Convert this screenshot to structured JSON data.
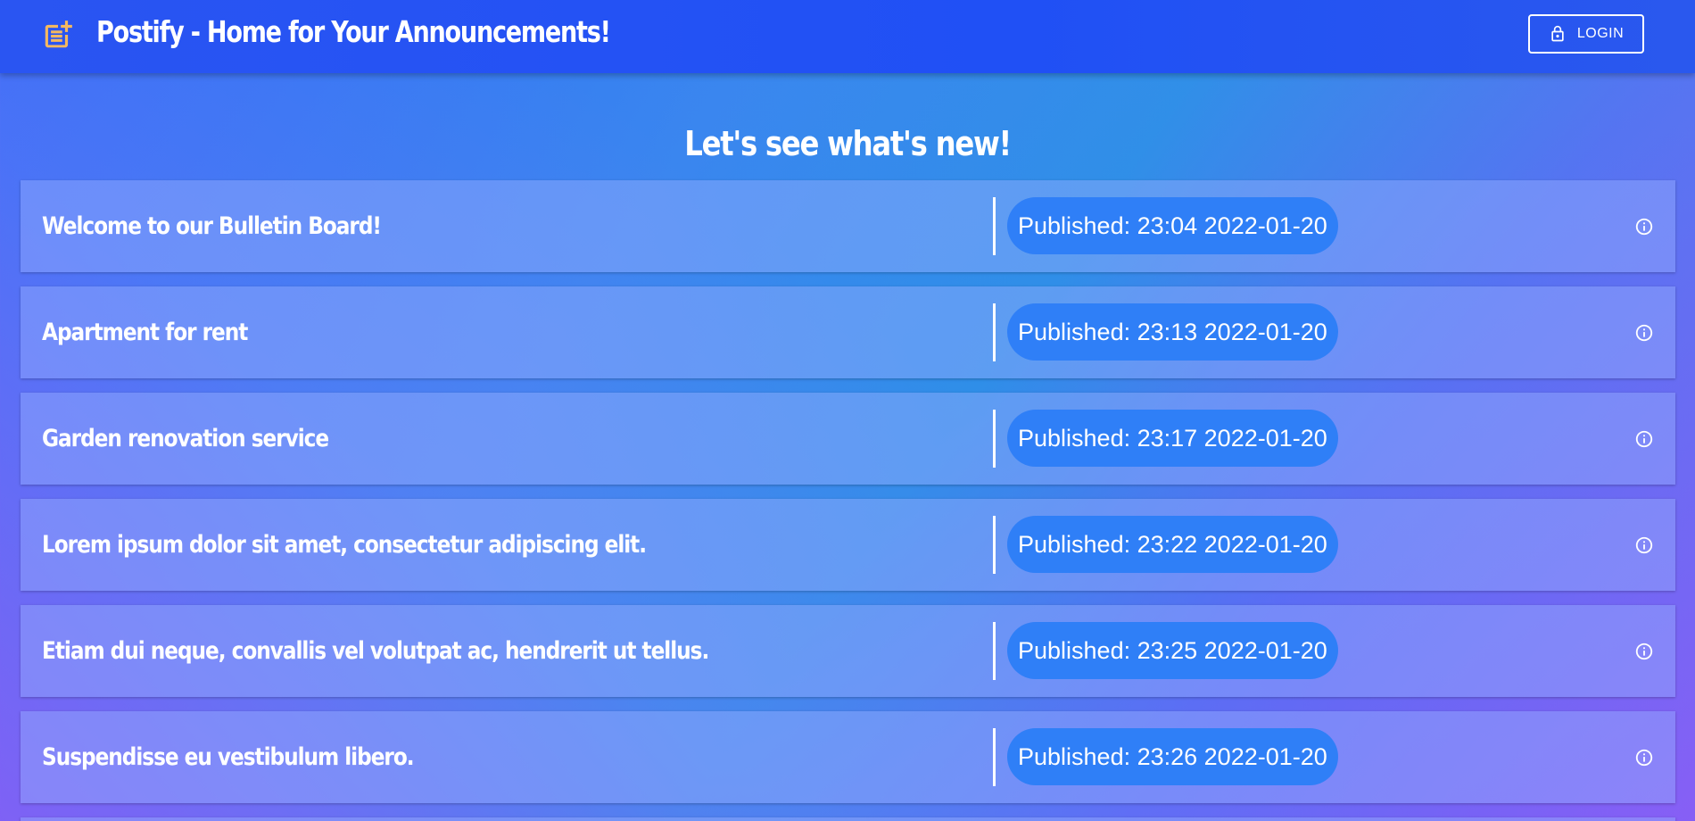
{
  "header": {
    "title": "Postify - Home for Your Announcements!",
    "app_icon": "post-add-icon",
    "app_icon_color": "#f4b860",
    "login_label": "LOGIN",
    "login_icon": "lock-icon"
  },
  "main": {
    "headline": "Let's see what's new!",
    "announcements": [
      {
        "title": "Welcome to our Bulletin Board!",
        "published": "Published: 23:04 2022-01-20",
        "icon": "info-icon"
      },
      {
        "title": "Apartment for rent",
        "published": "Published: 23:13 2022-01-20",
        "icon": "info-icon"
      },
      {
        "title": "Garden renovation service",
        "published": "Published: 23:17 2022-01-20",
        "icon": "info-icon"
      },
      {
        "title": "Lorem ipsum dolor sit amet, consectetur adipiscing elit.",
        "published": "Published: 23:22 2022-01-20",
        "icon": "info-icon"
      },
      {
        "title": "Etiam dui neque, convallis vel volutpat ac, hendrerit ut tellus.",
        "published": "Published: 23:25 2022-01-20",
        "icon": "info-icon"
      },
      {
        "title": "Suspendisse eu vestibulum libero.",
        "published": "Published: 23:26 2022-01-20",
        "icon": "info-icon"
      }
    ]
  },
  "colors": {
    "appbar": "#2050f5",
    "chip": "#2f7ff7",
    "text": "#ffffff"
  }
}
